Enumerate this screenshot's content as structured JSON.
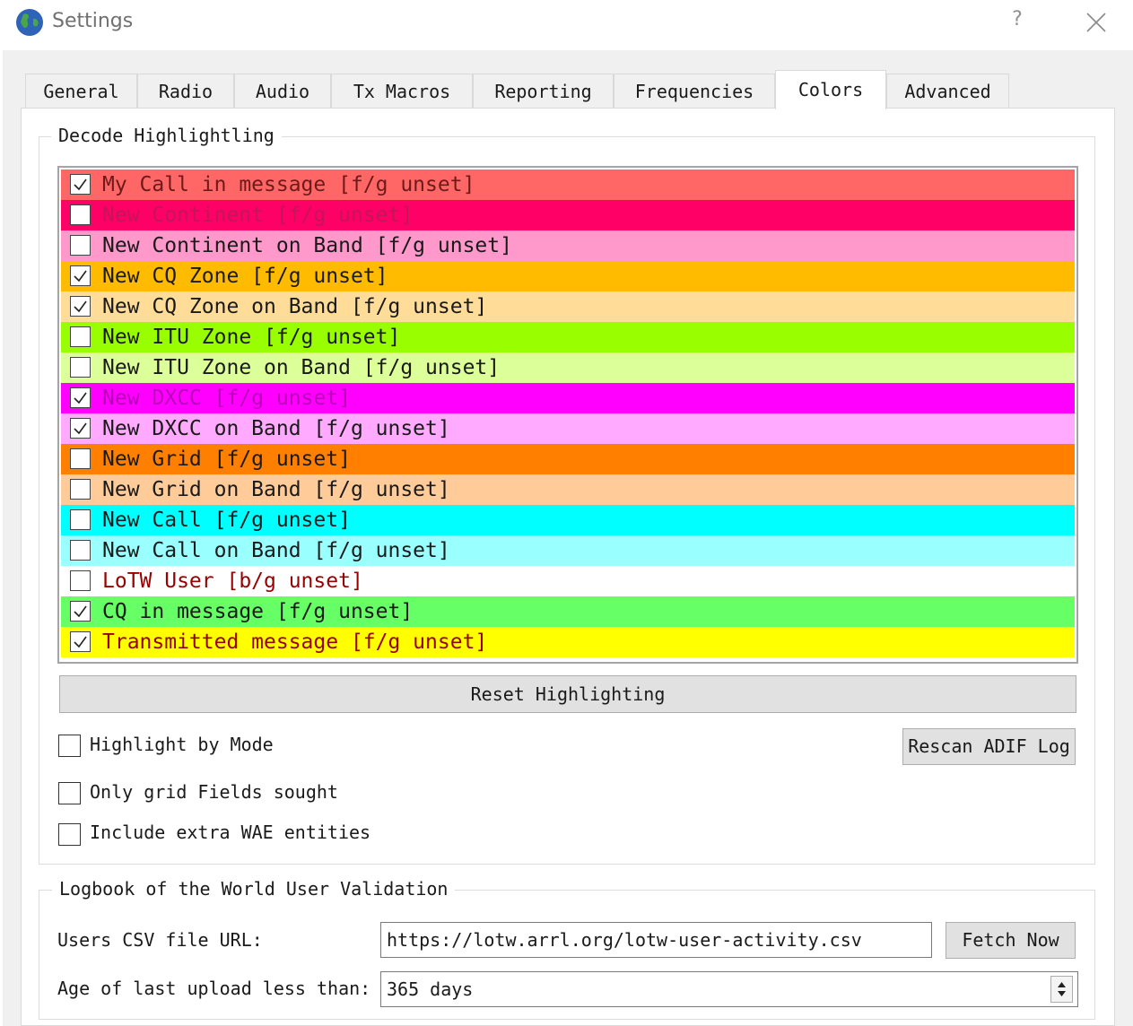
{
  "window": {
    "title": "Settings",
    "help": "?"
  },
  "tabs": [
    {
      "label": "General"
    },
    {
      "label": "Radio"
    },
    {
      "label": "Audio"
    },
    {
      "label": "Tx Macros"
    },
    {
      "label": "Reporting"
    },
    {
      "label": "Frequencies"
    },
    {
      "label": "Colors",
      "selected": true
    },
    {
      "label": "Advanced"
    }
  ],
  "decode": {
    "group_title": "Decode Highlightling",
    "items": [
      {
        "label": "My Call in message [f/g unset]",
        "checked": true,
        "bg": "#ff6666",
        "fg": "#6e1a1a"
      },
      {
        "label": "New Continent [f/g unset]",
        "checked": false,
        "bg": "#ff0066",
        "fg": "#c4145a"
      },
      {
        "label": "New Continent on Band [f/g unset]",
        "checked": false,
        "bg": "#ff99cc",
        "fg": "#1a1a1a"
      },
      {
        "label": "New CQ Zone [f/g unset]",
        "checked": true,
        "bg": "#ffbb00",
        "fg": "#1a1a1a"
      },
      {
        "label": "New CQ Zone on Band [f/g unset]",
        "checked": true,
        "bg": "#ffdd99",
        "fg": "#1a1a1a"
      },
      {
        "label": "New ITU Zone [f/g unset]",
        "checked": false,
        "bg": "#99ff00",
        "fg": "#1a1a1a"
      },
      {
        "label": "New ITU Zone on Band [f/g unset]",
        "checked": false,
        "bg": "#ddff99",
        "fg": "#1a1a1a"
      },
      {
        "label": "New DXCC [f/g unset]",
        "checked": true,
        "bg": "#ff00ff",
        "fg": "#b800b8"
      },
      {
        "label": "New DXCC on Band [f/g unset]",
        "checked": true,
        "bg": "#ffaaff",
        "fg": "#1a1a1a"
      },
      {
        "label": "New Grid [f/g unset]",
        "checked": false,
        "bg": "#ff8000",
        "fg": "#1a1a1a"
      },
      {
        "label": "New Grid on Band [f/g unset]",
        "checked": false,
        "bg": "#ffcc99",
        "fg": "#1a1a1a"
      },
      {
        "label": "New Call [f/g unset]",
        "checked": false,
        "bg": "#00ffff",
        "fg": "#1a1a1a"
      },
      {
        "label": "New Call on Band [f/g unset]",
        "checked": false,
        "bg": "#99ffff",
        "fg": "#1a1a1a"
      },
      {
        "label": "LoTW User [b/g unset]",
        "checked": false,
        "bg": "#ffffff",
        "fg": "#990000"
      },
      {
        "label": "CQ in message [f/g unset]",
        "checked": true,
        "bg": "#66ff66",
        "fg": "#1a1a1a"
      },
      {
        "label": "Transmitted message [f/g unset]",
        "checked": true,
        "bg": "#ffff00",
        "fg": "#990000"
      }
    ],
    "reset_button": "Reset Highlighting",
    "rescan_button": "Rescan ADIF Log",
    "options": [
      {
        "label": "Highlight by Mode",
        "checked": false
      },
      {
        "label": "Only grid Fields sought",
        "checked": false
      },
      {
        "label": "Include extra WAE entities",
        "checked": false
      }
    ]
  },
  "lotw": {
    "group_title": "Logbook of the World User Validation",
    "url_label": "Users CSV file URL:",
    "url_value": "https://lotw.arrl.org/lotw-user-activity.csv",
    "fetch_button": "Fetch Now",
    "age_label": "Age of last upload less than:",
    "age_value": "365 days"
  }
}
